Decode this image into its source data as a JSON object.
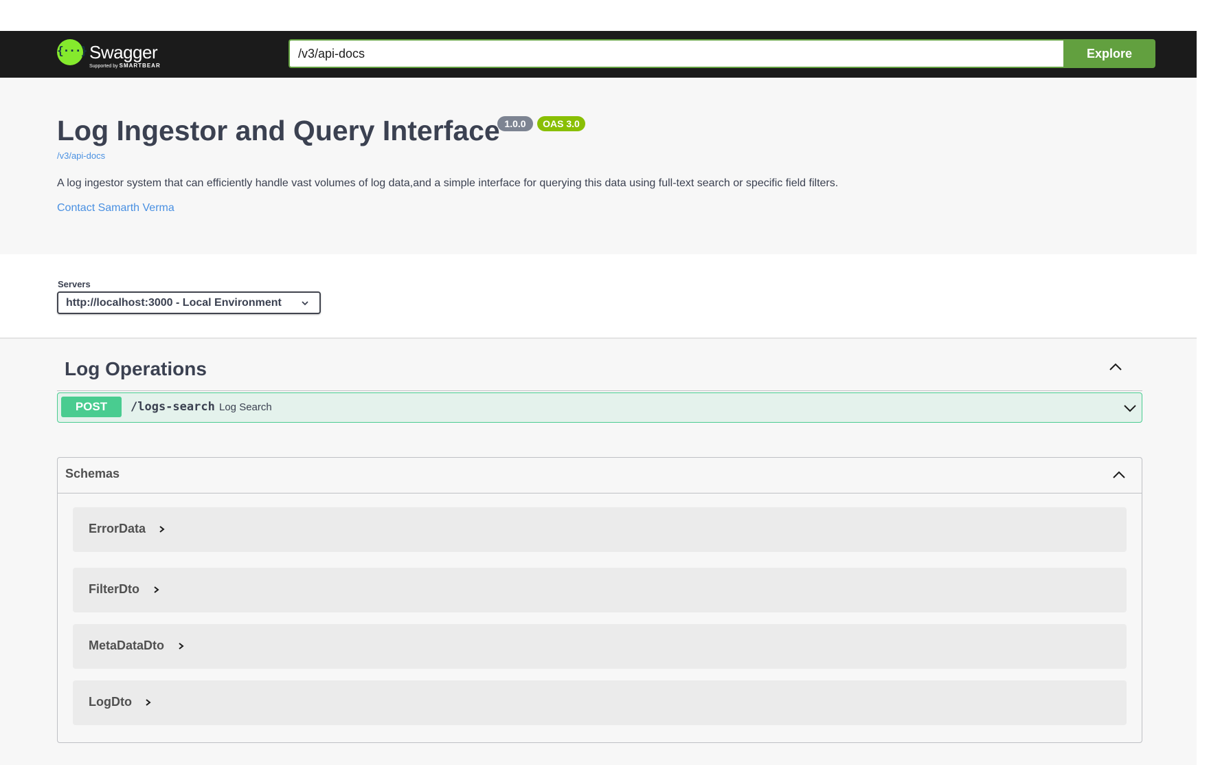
{
  "topbar": {
    "logo_text": "Swagger",
    "logo_sub_prefix": "Supported by",
    "logo_sub_brand": "SMARTBEAR",
    "logo_glyph": "{···}",
    "url_value": "/v3/api-docs",
    "explore_label": "Explore",
    "bg_color": "#1b1b1b",
    "accent_color": "#62a03f"
  },
  "info": {
    "title": "Log Ingestor and Query Interface",
    "version_badge": "1.0.0",
    "oas_badge": "OAS 3.0",
    "spec_link": "/v3/api-docs",
    "description": "A log ingestor system that can efficiently handle vast volumes of log data,and a simple interface for querying this data using full-text search or specific field filters.",
    "contact_link": "Contact Samarth Verma"
  },
  "servers": {
    "label": "Servers",
    "selected": "http://localhost:3000 - Local Environment"
  },
  "tag": {
    "title": "Log Operations",
    "expanded": true,
    "operations": [
      {
        "method": "POST",
        "path": "/logs-search",
        "summary": "Log Search",
        "method_color": "#49cc90"
      }
    ]
  },
  "schemas": {
    "title": "Schemas",
    "expanded": true,
    "items": [
      {
        "name": "ErrorData"
      },
      {
        "name": "FilterDto"
      },
      {
        "name": "MetaDataDto"
      },
      {
        "name": "LogDto"
      }
    ]
  },
  "icons": {
    "select_chevron": "chevron-down-icon",
    "collapse": "chevron-up-icon",
    "expand": "chevron-down-icon",
    "model_expand": "chevron-right-icon"
  }
}
